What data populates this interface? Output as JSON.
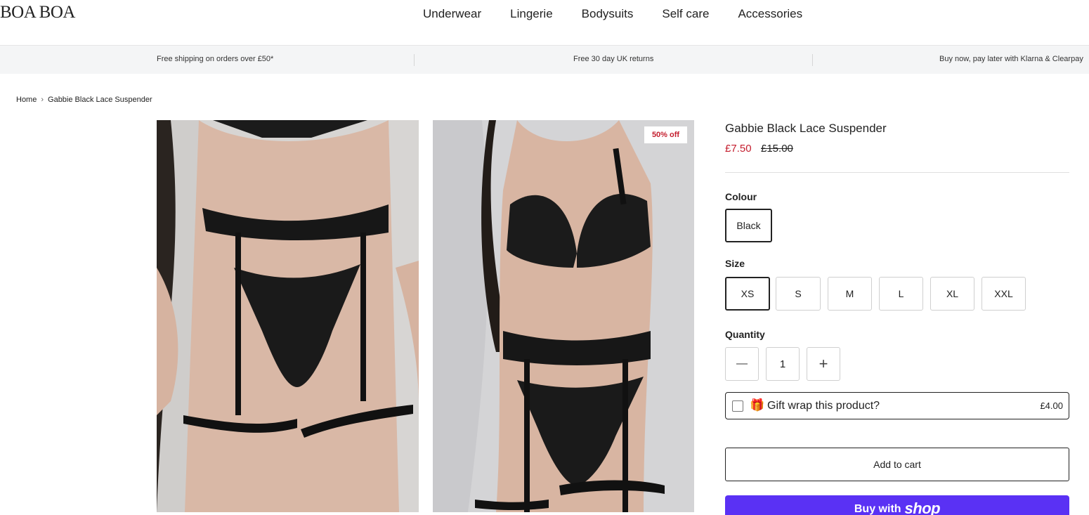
{
  "header": {
    "logo": "BOA BOA",
    "nav": [
      "Underwear",
      "Lingerie",
      "Bodysuits",
      "Self care",
      "Accessories"
    ]
  },
  "announcements": [
    "Free shipping on orders over £50*",
    "Free 30 day UK returns",
    "Buy now, pay later with Klarna & Clearpay"
  ],
  "breadcrumb": {
    "home": "Home",
    "separator": "›",
    "current": "Gabbie Black Lace Suspender"
  },
  "gallery": {
    "badge": "50% off"
  },
  "product": {
    "title": "Gabbie Black Lace Suspender",
    "price_sale": "£7.50",
    "price_original": "£15.00",
    "colour_label": "Colour",
    "colours": [
      "Black"
    ],
    "selected_colour": "Black",
    "size_label": "Size",
    "sizes": [
      "XS",
      "S",
      "M",
      "L",
      "XL",
      "XXL"
    ],
    "selected_size": "XS",
    "quantity_label": "Quantity",
    "quantity": "1",
    "qty_minus": "—",
    "qty_plus": "+",
    "giftwrap_icon": "🎁",
    "giftwrap_label": "Gift wrap this product?",
    "giftwrap_price": "£4.00",
    "add_to_cart": "Add to cart",
    "buy_with": "Buy with",
    "shop_pay": "shop"
  },
  "colors": {
    "sale_red": "#c41e2e",
    "shop_pay_purple": "#5a31f4"
  }
}
